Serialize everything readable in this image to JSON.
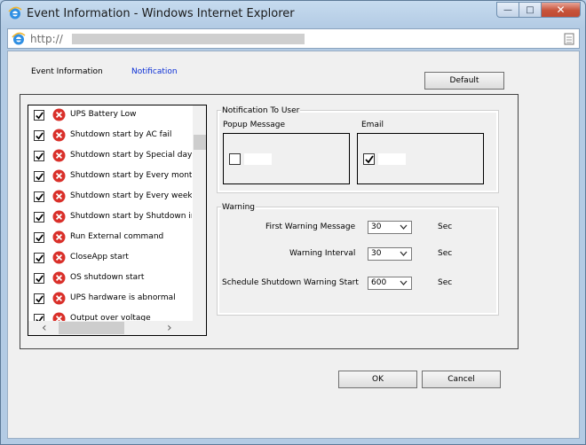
{
  "window": {
    "title": "Event Information - Windows Internet Explorer",
    "address": "http://",
    "min_glyph": "—",
    "max_glyph": "□",
    "close_glyph": "✕"
  },
  "tabs": {
    "info": "Event Information",
    "notification": "Notification"
  },
  "buttons": {
    "default": "Default",
    "ok": "OK",
    "cancel": "Cancel"
  },
  "events": [
    {
      "label": "UPS Battery Low",
      "checked": true
    },
    {
      "label": "Shutdown start by AC fail",
      "checked": true
    },
    {
      "label": "Shutdown start by Special day sc",
      "checked": true
    },
    {
      "label": "Shutdown start by Every month s",
      "checked": true
    },
    {
      "label": "Shutdown start by Every week sc",
      "checked": true
    },
    {
      "label": "Shutdown start by Shutdown imm",
      "checked": true
    },
    {
      "label": "Run External command",
      "checked": true
    },
    {
      "label": "CloseApp start",
      "checked": true
    },
    {
      "label": "OS shutdown start",
      "checked": true
    },
    {
      "label": "UPS hardware is abnormal",
      "checked": true
    },
    {
      "label": "Output over voltage",
      "checked": true
    }
  ],
  "notify_user": {
    "legend": "Notification To User",
    "popup_label": "Popup Message",
    "popup_checked": false,
    "email_label": "Email",
    "email_checked": true
  },
  "warning": {
    "legend": "Warning",
    "first_label": "First Warning Message",
    "first_value": "30",
    "interval_label": "Warning Interval",
    "interval_value": "30",
    "schedule_label": "Schedule Shutdown Warning Start",
    "schedule_value": "600",
    "unit": "Sec"
  },
  "icons": {
    "browser": "ie-icon",
    "error": "error-icon",
    "check": "checkmark-icon"
  },
  "colors": {
    "error_red": "#d9302a",
    "link_blue": "#0b2fd6"
  }
}
